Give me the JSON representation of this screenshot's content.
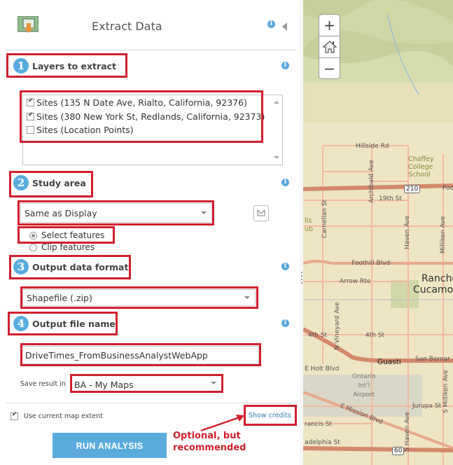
{
  "header": {
    "title": "Extract Data",
    "info_icon": "info-icon",
    "collapse_icon": "chevron-left-icon",
    "tool_icon": "extract-data-icon"
  },
  "steps": [
    {
      "number": "1",
      "label": "Layers to extract"
    },
    {
      "number": "2",
      "label": "Study area"
    },
    {
      "number": "3",
      "label": "Output data format"
    },
    {
      "number": "4",
      "label": "Output file name"
    }
  ],
  "layers": [
    {
      "label": "Sites (135 N Date Ave, Rialto, California, 92376)",
      "checked": true
    },
    {
      "label": "Sites (380 New York St, Redlands, California, 92373)",
      "checked": true
    },
    {
      "label": "Sites (Location Points)",
      "checked": false
    }
  ],
  "study_area": {
    "selected": "Same as Display",
    "options": [
      {
        "label": "Select features",
        "checked": true
      },
      {
        "label": "Clip features",
        "checked": false
      }
    ]
  },
  "output_format": {
    "selected": "Shapefile (.zip)"
  },
  "output_name": {
    "value": "DriveTimes_FromBusinessAnalystWebApp"
  },
  "save_result": {
    "label": "Save result in",
    "selected": "BA - My Maps"
  },
  "footer": {
    "use_extent_label": "Use current map extent",
    "use_extent_checked": true,
    "show_credits": "Show credits",
    "run_button": "RUN ANALYSIS"
  },
  "annotation": {
    "line1": "Optional, but",
    "line2": "recommended"
  },
  "colors": {
    "accent": "#5aabdc",
    "highlight": "#d0202e",
    "link": "#2f7eb1"
  },
  "map": {
    "zoom_in": "+",
    "zoom_out": "−",
    "home_icon": "home-icon",
    "labels": {
      "hillside": "Hillside Rd",
      "chaffey1": "Chaffey",
      "chaffey2": "College",
      "chaffey3": "School",
      "archibald": "Archibald Ave",
      "route210": "210",
      "foothill_partial": "Foo",
      "nineteenth": "19th St",
      "carnelian": "Carnelian St",
      "haven": "Haven Ave",
      "milliken": "Milliken Ave",
      "hills_partial": "lls",
      "club_partial": "ub",
      "foothill": "Foothill Blvd",
      "arrow": "Arrow Rte",
      "rancho1": "Rancho",
      "rancho2": "Cucamonga",
      "vineyard": "N Vineyard Ave",
      "fourth_w": "4th St",
      "fourth": "4th St",
      "guasti": "Guasti",
      "sanbern": "San Bernar",
      "holt": "E Holt Blvd",
      "ontario1": "Ontario",
      "ontario2": "Int'l",
      "ontario3": "Airport",
      "mission": "E Mission Blvd",
      "jurupa": "Jurupa St",
      "s_milliken": "S Milliken Ave",
      "s_haven": "S Haven Ave",
      "francis": "rancis St",
      "philadelphia": "adelphia St",
      "route60": "60"
    }
  }
}
